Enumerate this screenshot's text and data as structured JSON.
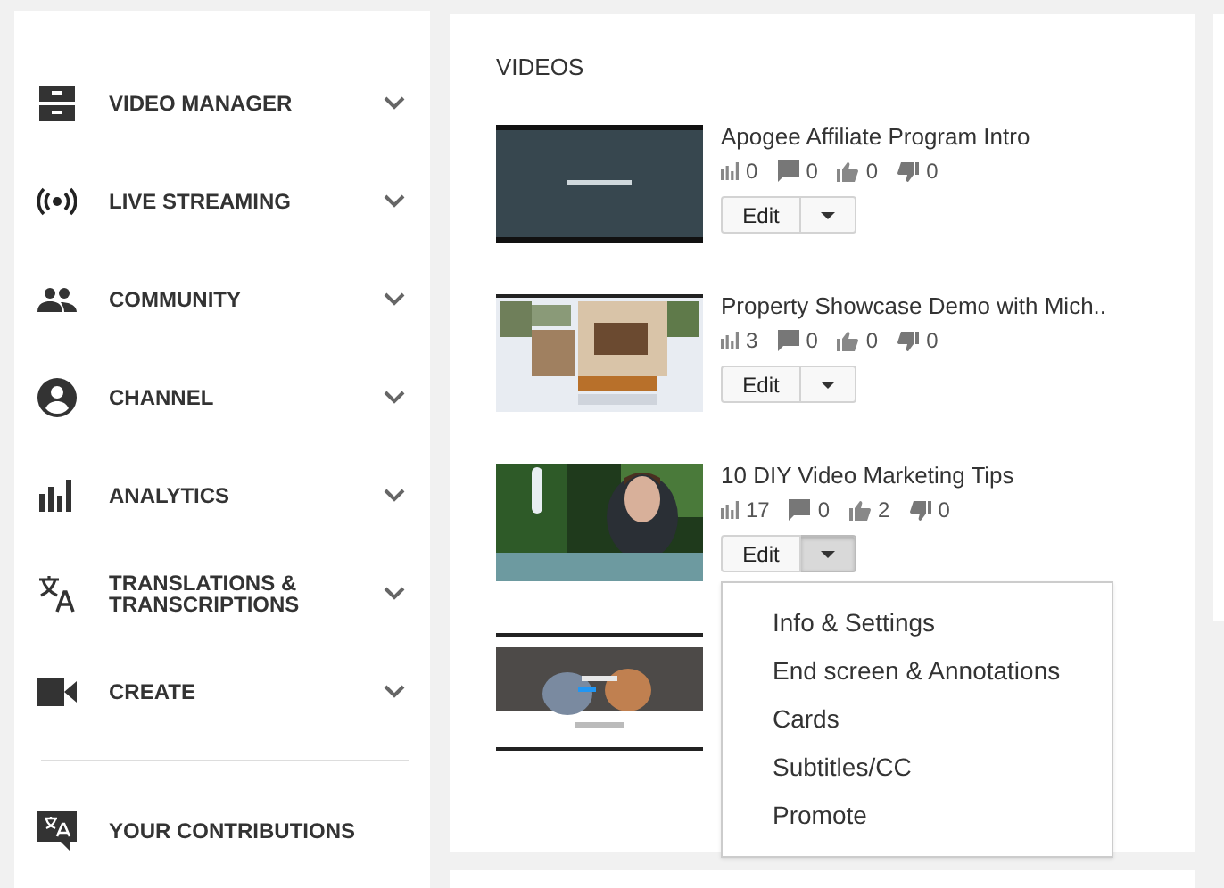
{
  "sidebar": {
    "items": [
      {
        "label": "VIDEO MANAGER",
        "expanded": false
      },
      {
        "label": "LIVE STREAMING",
        "expanded": false
      },
      {
        "label": "COMMUNITY",
        "expanded": false
      },
      {
        "label": "CHANNEL",
        "expanded": false
      },
      {
        "label": "ANALYTICS",
        "expanded": false
      },
      {
        "label": "TRANSLATIONS & TRANSCRIPTIONS",
        "expanded": false
      },
      {
        "label": "CREATE",
        "expanded": false
      }
    ],
    "footer": {
      "label": "YOUR CONTRIBUTIONS"
    }
  },
  "videos": {
    "heading": "VIDEOS",
    "items": [
      {
        "kind": "full",
        "title": "Apogee Affiliate Program Intro",
        "views": "0",
        "comments": "0",
        "likes": "0",
        "dislikes": "0",
        "edit": "Edit",
        "menu_open": false
      },
      {
        "kind": "full",
        "title": "Property Showcase Demo with Mich..",
        "views": "3",
        "comments": "0",
        "likes": "0",
        "dislikes": "0",
        "edit": "Edit",
        "menu_open": false
      },
      {
        "kind": "full",
        "title": "10 DIY Video Marketing Tips",
        "views": "17",
        "comments": "0",
        "likes": "2",
        "dislikes": "0",
        "edit": "Edit",
        "menu_open": true
      },
      {
        "kind": "covered"
      }
    ],
    "menu": [
      "Info & Settings",
      "End screen & Annotations",
      "Cards",
      "Subtitles/CC",
      "Promote"
    ]
  }
}
